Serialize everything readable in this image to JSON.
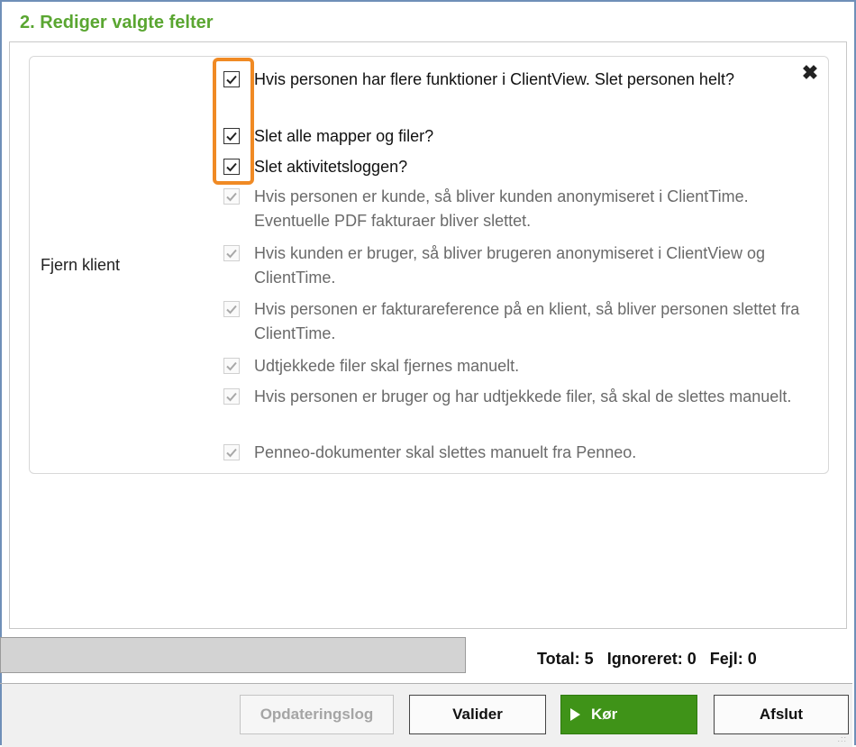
{
  "section": {
    "title": "2. Rediger valgte felter"
  },
  "row": {
    "label": "Fjern klient",
    "options": [
      {
        "text": "Hvis personen har flere funktioner i ClientView. Slet personen helt?",
        "checked": true,
        "enabled": true
      },
      {
        "text": "Slet alle mapper og filer?",
        "checked": true,
        "enabled": true
      },
      {
        "text": "Slet aktivitetsloggen?",
        "checked": true,
        "enabled": true
      },
      {
        "text": "Hvis personen er kunde, så bliver kunden anonymiseret i ClientTime. Eventuelle PDF fakturaer bliver slettet.",
        "checked": true,
        "enabled": false
      },
      {
        "text": "Hvis kunden er bruger, så bliver brugeren anonymiseret i ClientView og ClientTime.",
        "checked": true,
        "enabled": false
      },
      {
        "text": "Hvis personen er fakturareference på en klient, så bliver personen slettet fra ClientTime.",
        "checked": true,
        "enabled": false
      },
      {
        "text": "Udtjekkede filer skal fjernes manuelt.",
        "checked": true,
        "enabled": false
      },
      {
        "text": "Hvis personen er bruger og har udtjekkede filer, så skal de slettes manuelt.",
        "checked": true,
        "enabled": false
      },
      {
        "text": "Penneo-dokumenter skal slettes manuelt fra Penneo.",
        "checked": true,
        "enabled": false
      }
    ]
  },
  "close_icon": "close-icon",
  "status": {
    "total": "Total: 5",
    "ignored": "Ignoreret: 0",
    "errors": "Fejl: 0"
  },
  "buttons": {
    "log": "Opdateringslog",
    "validate": "Valider",
    "run": "Kør",
    "exit": "Afslut"
  },
  "colors": {
    "title": "#5aa631",
    "run_button": "#3f9318",
    "highlight": "#f08a24"
  }
}
